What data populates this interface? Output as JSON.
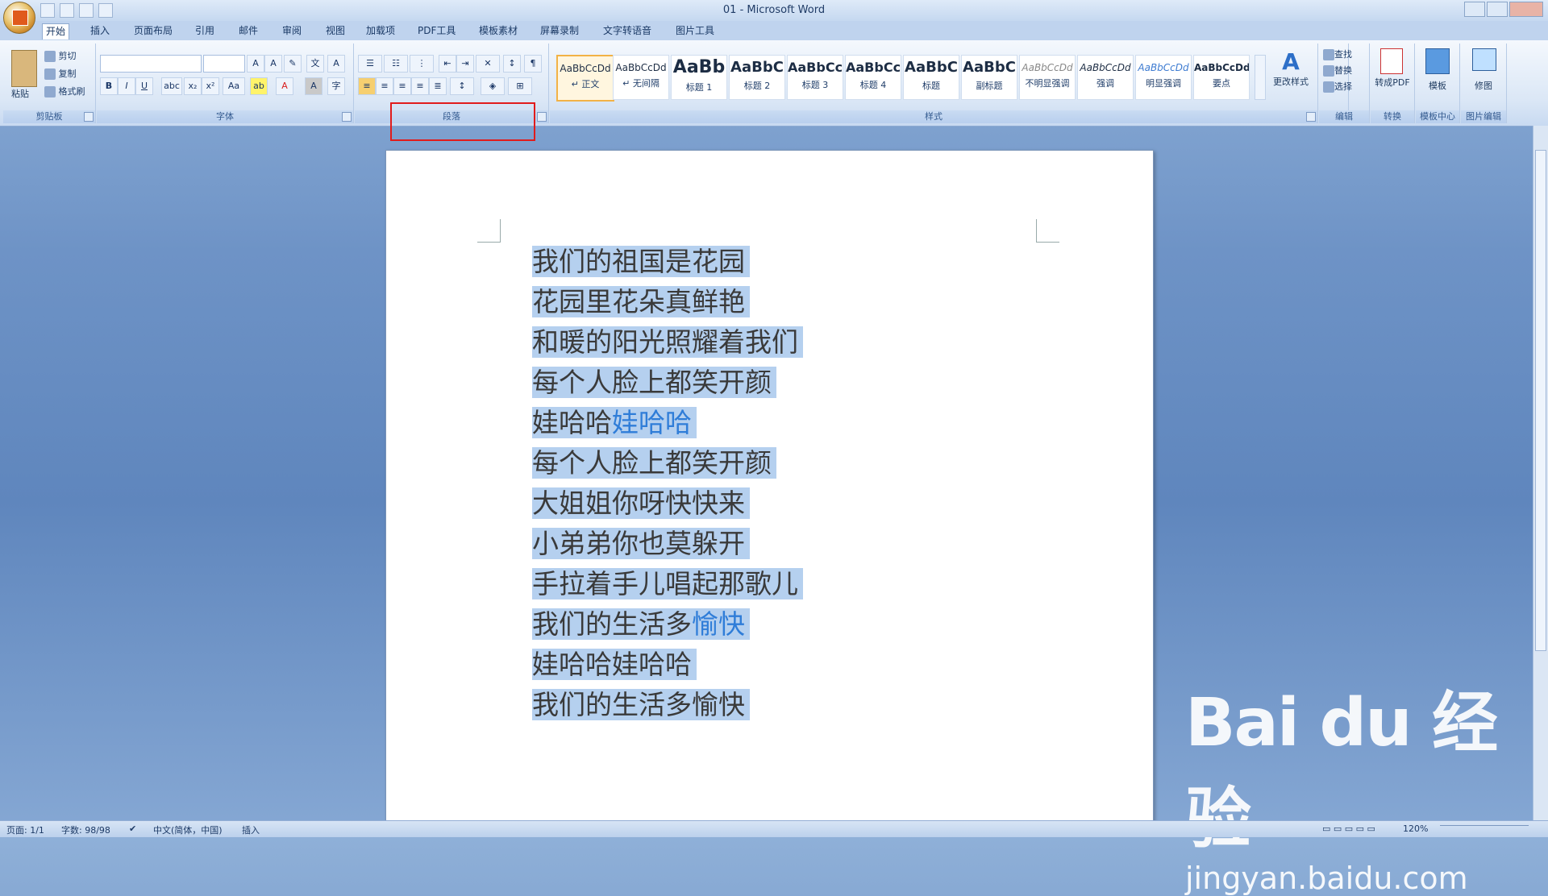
{
  "window": {
    "title": "01 - Microsoft Word"
  },
  "tabs": [
    "开始",
    "插入",
    "页面布局",
    "引用",
    "邮件",
    "审阅",
    "视图",
    "加载项",
    "PDF工具",
    "模板素材",
    "屏幕录制",
    "文字转语音",
    "图片工具"
  ],
  "clipboard": {
    "paste": "粘贴",
    "cut": "剪切",
    "copy": "复制",
    "format_painter": "格式刷",
    "label": "剪贴板"
  },
  "font_group": {
    "label": "字体"
  },
  "paragraph_group": {
    "label": "段落"
  },
  "styles": {
    "label": "样式",
    "items": [
      {
        "sample": "AaBbCcDd",
        "name": "↵ 正文"
      },
      {
        "sample": "AaBbCcDd",
        "name": "↵ 无间隔"
      },
      {
        "sample": "AaBb",
        "name": "标题 1"
      },
      {
        "sample": "AaBbC",
        "name": "标题 2"
      },
      {
        "sample": "AaBbCc",
        "name": "标题 3"
      },
      {
        "sample": "AaBbCc",
        "name": "标题 4"
      },
      {
        "sample": "AaBbC",
        "name": "标题"
      },
      {
        "sample": "AaBbC",
        "name": "副标题"
      },
      {
        "sample": "AaBbCcDd",
        "name": "不明显强调"
      },
      {
        "sample": "AaBbCcDd",
        "name": "强调"
      },
      {
        "sample": "AaBbCcDd",
        "name": "明显强调"
      },
      {
        "sample": "AaBbCcDd",
        "name": "要点"
      }
    ],
    "change_styles": "更改样式"
  },
  "editing": {
    "find": "查找",
    "replace": "替换",
    "select": "选择",
    "label": "编辑"
  },
  "convert": {
    "pdf": "转成PDF",
    "label": "转换"
  },
  "template": {
    "btn": "模板",
    "label": "模板中心"
  },
  "picture": {
    "btn": "修图",
    "label": "图片编辑"
  },
  "document": {
    "lines": [
      {
        "a": "我们的祖国是花园",
        "b": ""
      },
      {
        "a": "花园里花朵真鲜艳",
        "b": ""
      },
      {
        "a": "和暖的阳光照耀着我们",
        "b": ""
      },
      {
        "a": "每个人脸上都笑开颜",
        "b": ""
      },
      {
        "a": "娃哈哈",
        "b": "娃哈哈"
      },
      {
        "a": "每个人脸上都笑开颜",
        "b": ""
      },
      {
        "a": "大姐姐你呀快快来",
        "b": ""
      },
      {
        "a": "小弟弟你也莫躲开",
        "b": ""
      },
      {
        "a": "手拉着手儿唱起那歌儿",
        "b": ""
      },
      {
        "a": "我们的生活多",
        "b": "愉快"
      },
      {
        "a": "娃哈哈娃哈哈",
        "b": ""
      },
      {
        "a": "我们的生活多愉快",
        "b": ""
      }
    ]
  },
  "status": {
    "page": "页面: 1/1",
    "words": "字数: 98/98",
    "lang": "中文(简体，中国)",
    "mode": "插入",
    "zoom": "120%"
  },
  "watermark": {
    "logo": "Bai du 经验",
    "url": "jingyan.baidu.com"
  }
}
